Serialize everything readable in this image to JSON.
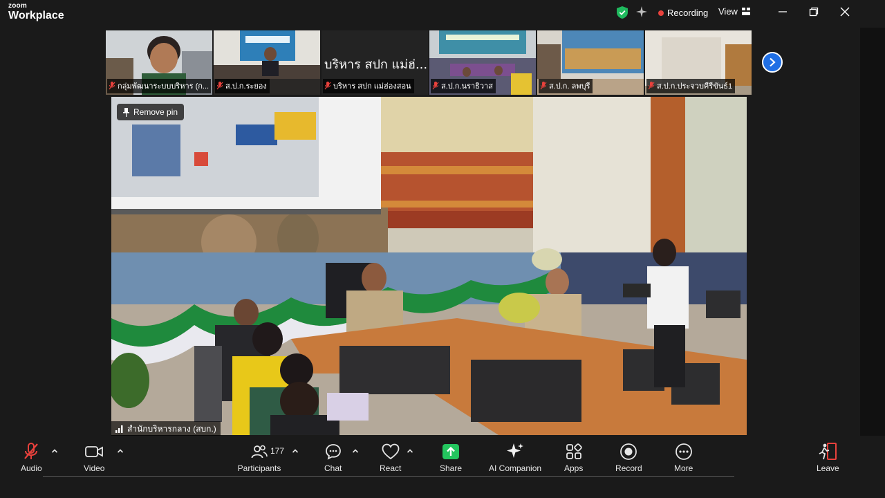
{
  "app": {
    "brand_small": "zoom",
    "brand_big": "Workplace",
    "recording_label": "Recording",
    "view_label": "View"
  },
  "gallery": [
    {
      "name": "กลุ่มพัฒนาระบบบริหาร (ก...",
      "muted": true
    },
    {
      "name": "ส.ป.ก.ระยอง",
      "muted": true
    },
    {
      "name": "บริหาร สปก แม่ฮ่องสอน",
      "big_label": "บริหาร สปก แม่ฮ่...",
      "muted": true
    },
    {
      "name": "ส.ป.ก.นราธิวาส",
      "muted": true
    },
    {
      "name": "ส.ป.ก. ลพบุรี",
      "muted": true
    },
    {
      "name": "ส.ป.ก.ประจวบคีรีขันธ์1",
      "muted": true
    }
  ],
  "main": {
    "remove_pin_label": "Remove pin",
    "speaker_name": "สำนักบริหารกลาง (สบก.)"
  },
  "toolbar": {
    "audio": "Audio",
    "video": "Video",
    "participants": "Participants",
    "participant_count": "177",
    "chat": "Chat",
    "react": "React",
    "share": "Share",
    "ai_companion": "AI Companion",
    "apps": "Apps",
    "record": "Record",
    "more": "More",
    "leave": "Leave"
  },
  "colors": {
    "accent_blue": "#1f6fe5",
    "share_green": "#23c55e",
    "mute_red": "#e8413c",
    "shield_green": "#1fba5e"
  }
}
